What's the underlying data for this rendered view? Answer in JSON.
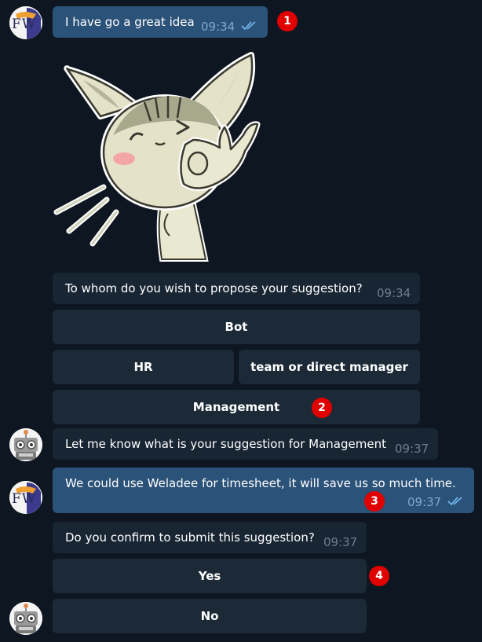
{
  "messages": [
    {
      "text": "I have go a great idea",
      "time": "09:34"
    },
    {
      "text": "To whom do you wish to propose your suggestion?",
      "time": "09:34"
    },
    {
      "text": "Let me know what is your suggestion for Management",
      "time": "09:37"
    },
    {
      "text": "We could use Weladee for timesheet, it will save us so much time.",
      "time": "09:37"
    },
    {
      "text": "Do you confirm to submit this suggestion?",
      "time": "09:37"
    }
  ],
  "keyboard1": {
    "bot": "Bot",
    "hr": "HR",
    "manager": "team or direct manager",
    "management": "Management"
  },
  "keyboard2": {
    "yes": "Yes",
    "no": "No"
  },
  "avatar": {
    "user_letters": "FW"
  },
  "badges": [
    "1",
    "2",
    "3",
    "4"
  ],
  "colors": {
    "background": "#0e1621",
    "outgoing": "#2b5278",
    "incoming": "#182533",
    "button": "#1c2a38",
    "badge": "#e00000"
  },
  "icons": [
    "double-check-icon",
    "cat-ok-sticker",
    "robot-avatar",
    "user-avatar"
  ]
}
